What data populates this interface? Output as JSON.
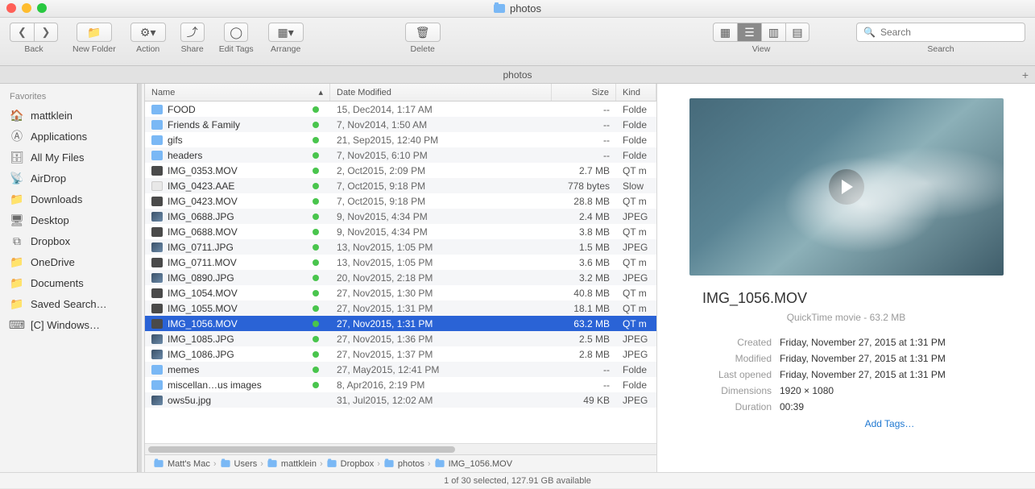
{
  "window": {
    "title": "photos"
  },
  "toolbar": {
    "back_label": "Back",
    "new_folder": "New Folder",
    "action": "Action",
    "share": "Share",
    "edit_tags": "Edit Tags",
    "arrange": "Arrange",
    "delete": "Delete",
    "view": "View",
    "search": "Search",
    "search_placeholder": "Search"
  },
  "tabbar": {
    "active_tab": "photos"
  },
  "sidebar": {
    "heading": "Favorites",
    "items": [
      {
        "label": "mattklein",
        "icon": "home"
      },
      {
        "label": "Applications",
        "icon": "apps"
      },
      {
        "label": "All My Files",
        "icon": "allfiles"
      },
      {
        "label": "AirDrop",
        "icon": "airdrop"
      },
      {
        "label": "Downloads",
        "icon": "folder"
      },
      {
        "label": "Desktop",
        "icon": "desktop"
      },
      {
        "label": "Dropbox",
        "icon": "dropbox"
      },
      {
        "label": "OneDrive",
        "icon": "folder"
      },
      {
        "label": "Documents",
        "icon": "folder"
      },
      {
        "label": "Saved Search…",
        "icon": "folder"
      },
      {
        "label": "[C] Windows…",
        "icon": "keyboard"
      }
    ]
  },
  "columns": {
    "name": "Name",
    "date": "Date Modified",
    "size": "Size",
    "kind": "Kind"
  },
  "files": [
    {
      "name": "FOOD",
      "date": "15, Dec2014, 1:17 AM",
      "size": "--",
      "kind": "Folde",
      "icon": "folder",
      "synced": true
    },
    {
      "name": "Friends & Family",
      "date": "7, Nov2014, 1:50 AM",
      "size": "--",
      "kind": "Folde",
      "icon": "folder",
      "synced": true
    },
    {
      "name": "gifs",
      "date": "21, Sep2015, 12:40 PM",
      "size": "--",
      "kind": "Folde",
      "icon": "folder",
      "synced": true
    },
    {
      "name": "headers",
      "date": "7, Nov2015, 6:10 PM",
      "size": "--",
      "kind": "Folde",
      "icon": "folder",
      "synced": true
    },
    {
      "name": "IMG_0353.MOV",
      "date": "2, Oct2015, 2:09 PM",
      "size": "2.7 MB",
      "kind": "QT m",
      "icon": "mov",
      "synced": true
    },
    {
      "name": "IMG_0423.AAE",
      "date": "7, Oct2015, 9:18 PM",
      "size": "778 bytes",
      "kind": "Slow",
      "icon": "doc",
      "synced": true
    },
    {
      "name": "IMG_0423.MOV",
      "date": "7, Oct2015, 9:18 PM",
      "size": "28.8 MB",
      "kind": "QT m",
      "icon": "mov",
      "synced": true
    },
    {
      "name": "IMG_0688.JPG",
      "date": "9, Nov2015, 4:34 PM",
      "size": "2.4 MB",
      "kind": "JPEG",
      "icon": "img",
      "synced": true
    },
    {
      "name": "IMG_0688.MOV",
      "date": "9, Nov2015, 4:34 PM",
      "size": "3.8 MB",
      "kind": "QT m",
      "icon": "mov",
      "synced": true
    },
    {
      "name": "IMG_0711.JPG",
      "date": "13, Nov2015, 1:05 PM",
      "size": "1.5 MB",
      "kind": "JPEG",
      "icon": "img",
      "synced": true
    },
    {
      "name": "IMG_0711.MOV",
      "date": "13, Nov2015, 1:05 PM",
      "size": "3.6 MB",
      "kind": "QT m",
      "icon": "mov",
      "synced": true
    },
    {
      "name": "IMG_0890.JPG",
      "date": "20, Nov2015, 2:18 PM",
      "size": "3.2 MB",
      "kind": "JPEG",
      "icon": "img",
      "synced": true
    },
    {
      "name": "IMG_1054.MOV",
      "date": "27, Nov2015, 1:30 PM",
      "size": "40.8 MB",
      "kind": "QT m",
      "icon": "mov",
      "synced": true
    },
    {
      "name": "IMG_1055.MOV",
      "date": "27, Nov2015, 1:31 PM",
      "size": "18.1 MB",
      "kind": "QT m",
      "icon": "mov",
      "synced": true
    },
    {
      "name": "IMG_1056.MOV",
      "date": "27, Nov2015, 1:31 PM",
      "size": "63.2 MB",
      "kind": "QT m",
      "icon": "mov",
      "synced": true,
      "selected": true
    },
    {
      "name": "IMG_1085.JPG",
      "date": "27, Nov2015, 1:36 PM",
      "size": "2.5 MB",
      "kind": "JPEG",
      "icon": "img",
      "synced": true
    },
    {
      "name": "IMG_1086.JPG",
      "date": "27, Nov2015, 1:37 PM",
      "size": "2.8 MB",
      "kind": "JPEG",
      "icon": "img",
      "synced": true
    },
    {
      "name": "memes",
      "date": "27, May2015, 12:41 PM",
      "size": "--",
      "kind": "Folde",
      "icon": "folder",
      "synced": true
    },
    {
      "name": "miscellan…us images",
      "date": "8, Apr2016, 2:19 PM",
      "size": "--",
      "kind": "Folde",
      "icon": "folder",
      "synced": true
    },
    {
      "name": "ows5u.jpg",
      "date": "31, Jul2015, 12:02 AM",
      "size": "49 KB",
      "kind": "JPEG",
      "icon": "img",
      "synced": false
    }
  ],
  "pathbar": [
    "Matt's Mac",
    "Users",
    "mattklein",
    "Dropbox",
    "photos",
    "IMG_1056.MOV"
  ],
  "statusbar": "1 of 30 selected, 127.91 GB available",
  "inspector": {
    "filename": "IMG_1056.MOV",
    "subtitle": "QuickTime movie - 63.2 MB",
    "rows": [
      {
        "label": "Created",
        "value": "Friday, November 27, 2015 at 1:31 PM"
      },
      {
        "label": "Modified",
        "value": "Friday, November 27, 2015 at 1:31 PM"
      },
      {
        "label": "Last opened",
        "value": "Friday, November 27, 2015 at 1:31 PM"
      },
      {
        "label": "Dimensions",
        "value": "1920 × 1080"
      },
      {
        "label": "Duration",
        "value": "00:39"
      }
    ],
    "add_tags": "Add Tags…"
  }
}
